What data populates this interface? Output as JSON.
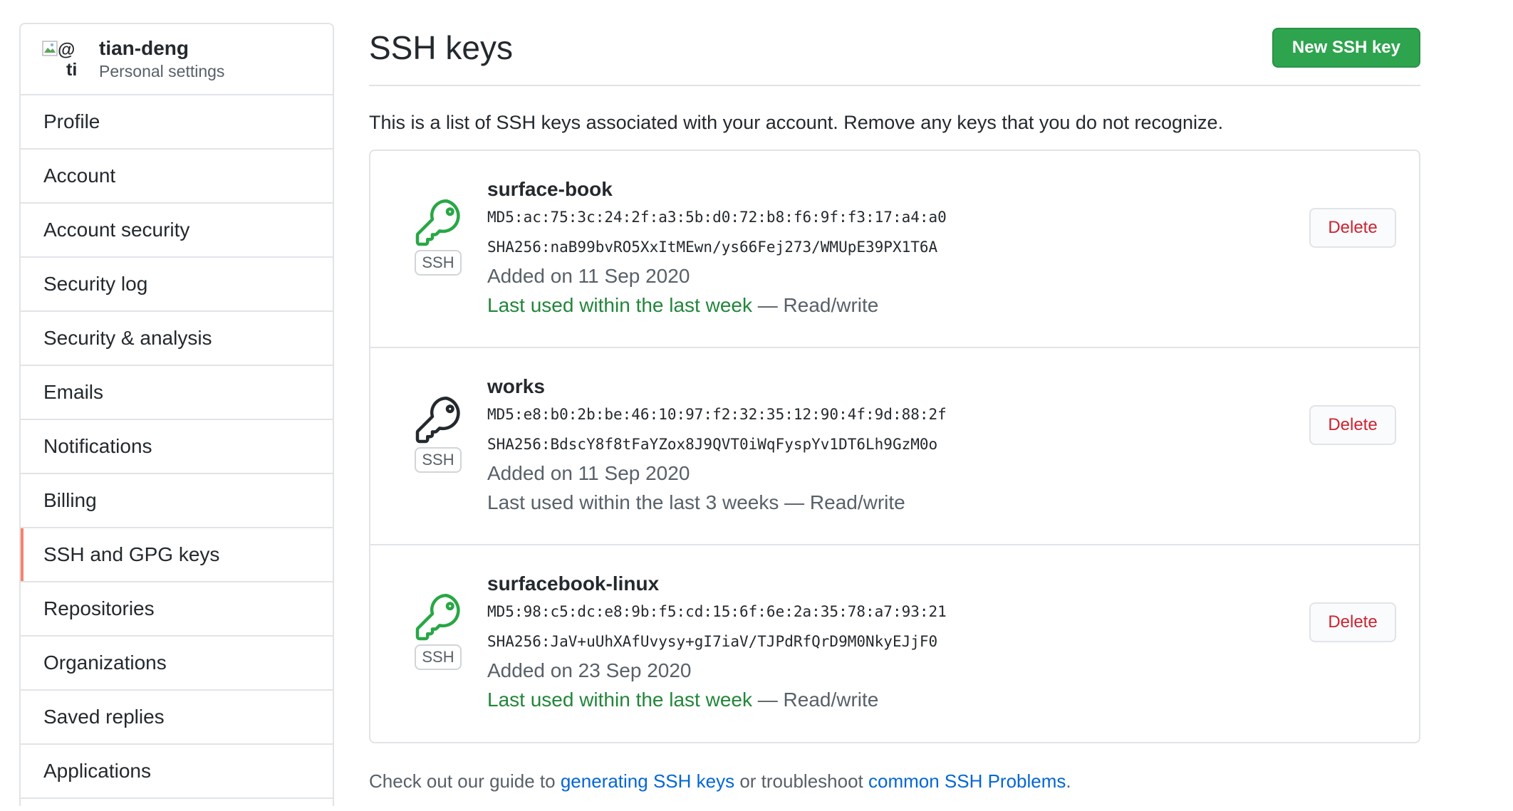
{
  "sidebar": {
    "profile": {
      "avatar_alt_line1": "@",
      "avatar_alt_line2": "ti",
      "username": "tian-deng",
      "subtitle": "Personal settings"
    },
    "items": [
      {
        "label": "Profile",
        "selected": false
      },
      {
        "label": "Account",
        "selected": false
      },
      {
        "label": "Account security",
        "selected": false
      },
      {
        "label": "Security log",
        "selected": false
      },
      {
        "label": "Security & analysis",
        "selected": false
      },
      {
        "label": "Emails",
        "selected": false
      },
      {
        "label": "Notifications",
        "selected": false
      },
      {
        "label": "Billing",
        "selected": false
      },
      {
        "label": "SSH and GPG keys",
        "selected": true
      },
      {
        "label": "Repositories",
        "selected": false
      },
      {
        "label": "Organizations",
        "selected": false
      },
      {
        "label": "Saved replies",
        "selected": false
      },
      {
        "label": "Applications",
        "selected": false
      }
    ]
  },
  "main": {
    "title": "SSH keys",
    "new_key_button": "New SSH key",
    "description": "This is a list of SSH keys associated with your account. Remove any keys that you do not recognize.",
    "keys": [
      {
        "name": "surface-book",
        "md5": "MD5:ac:75:3c:24:2f:a3:5b:d0:72:b8:f6:9f:f3:17:a4:a0",
        "sha256": "SHA256:naB99bvRO5XxItMEwn/ys66Fej273/WMUpE39PX1T6A",
        "added": "Added on 11 Sep 2020",
        "last_used": "Last used within the last week",
        "access": " — Read/write",
        "recent": true,
        "badge": "SSH",
        "delete_label": "Delete",
        "icon": "key-icon",
        "icon_color": "#28a745"
      },
      {
        "name": "works",
        "md5": "MD5:e8:b0:2b:be:46:10:97:f2:32:35:12:90:4f:9d:88:2f",
        "sha256": "SHA256:BdscY8f8tFaYZox8J9QVT0iWqFyspYv1DT6Lh9GzM0o",
        "added": "Added on 11 Sep 2020",
        "last_used": "Last used within the last 3 weeks",
        "access": " — Read/write",
        "recent": false,
        "badge": "SSH",
        "delete_label": "Delete",
        "icon": "key-icon",
        "icon_color": "#24292e"
      },
      {
        "name": "surfacebook-linux",
        "md5": "MD5:98:c5:dc:e8:9b:f5:cd:15:6f:6e:2a:35:78:a7:93:21",
        "sha256": "SHA256:JaV+uUhXAfUvysy+gI7iaV/TJPdRfQrD9M0NkyEJjF0",
        "added": "Added on 23 Sep 2020",
        "last_used": "Last used within the last week",
        "access": " — Read/write",
        "recent": true,
        "badge": "SSH",
        "delete_label": "Delete",
        "icon": "key-icon",
        "icon_color": "#28a745"
      }
    ],
    "footer": {
      "prefix": "Check out our guide to ",
      "link1": "generating SSH keys",
      "middle": " or troubleshoot ",
      "link2": "common SSH Problems",
      "suffix": "."
    }
  },
  "colors": {
    "primary_button": "#2ea44f",
    "danger": "#cb2431",
    "link": "#0366d6",
    "recent_green": "#22863a",
    "selected_indicator": "#f9826c"
  }
}
